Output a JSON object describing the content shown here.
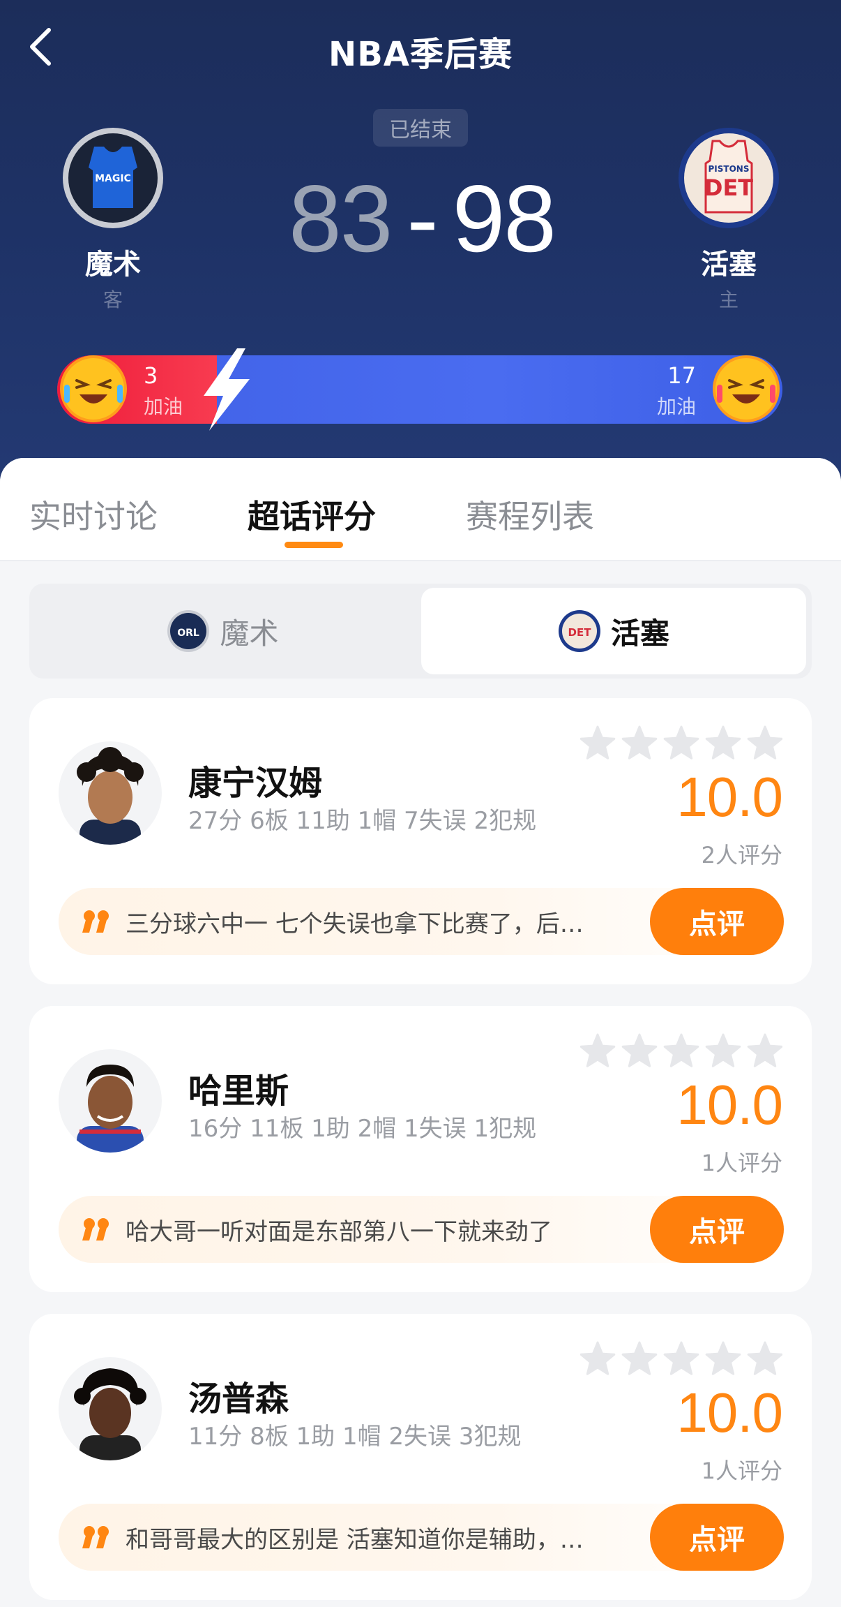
{
  "nav": {
    "title": "NBA季后赛"
  },
  "match": {
    "status": "已结束",
    "away": {
      "name": "魔术",
      "role": "客",
      "score": "83",
      "logo_text": "MAGIC"
    },
    "separator": "-",
    "home": {
      "name": "活塞",
      "role": "主",
      "score": "98",
      "logo_text": "DET",
      "logo_sub": "PISTONS"
    }
  },
  "cheer": {
    "away_count": "3",
    "away_label": "加油",
    "home_count": "17",
    "home_label": "加油",
    "away_share": 0.15
  },
  "tabs": [
    "实时讨论",
    "超话评分",
    "赛程列表"
  ],
  "active_tab": "超话评分",
  "team_switch": {
    "left": "魔术",
    "left_logo": "ORL",
    "right": "活塞",
    "right_logo": "DET",
    "selected": "活塞"
  },
  "players": [
    {
      "name": "康宁汉姆",
      "stats": "27分 6板 11助 1帽 7失误 2犯规",
      "rating": "10.0",
      "rating_count": "2人评分",
      "comment": "三分球六中一 七个失误也拿下比赛了，后…",
      "button": "点评"
    },
    {
      "name": "哈里斯",
      "stats": "16分 11板 1助 2帽 1失误 1犯规",
      "rating": "10.0",
      "rating_count": "1人评分",
      "comment": "哈大哥一听对面是东部第八一下就来劲了",
      "button": "点评"
    },
    {
      "name": "汤普森",
      "stats": "11分 8板 1助 1帽 2失误 3犯规",
      "rating": "10.0",
      "rating_count": "1人评分",
      "comment": "和哥哥最大的区别是 活塞知道你是辅助，…",
      "button": "点评"
    }
  ],
  "colors": {
    "accent": "#ff7f0c",
    "header_bg": "#1e3266",
    "away_red": "#ee1c3a",
    "home_blue": "#3f60e6"
  }
}
